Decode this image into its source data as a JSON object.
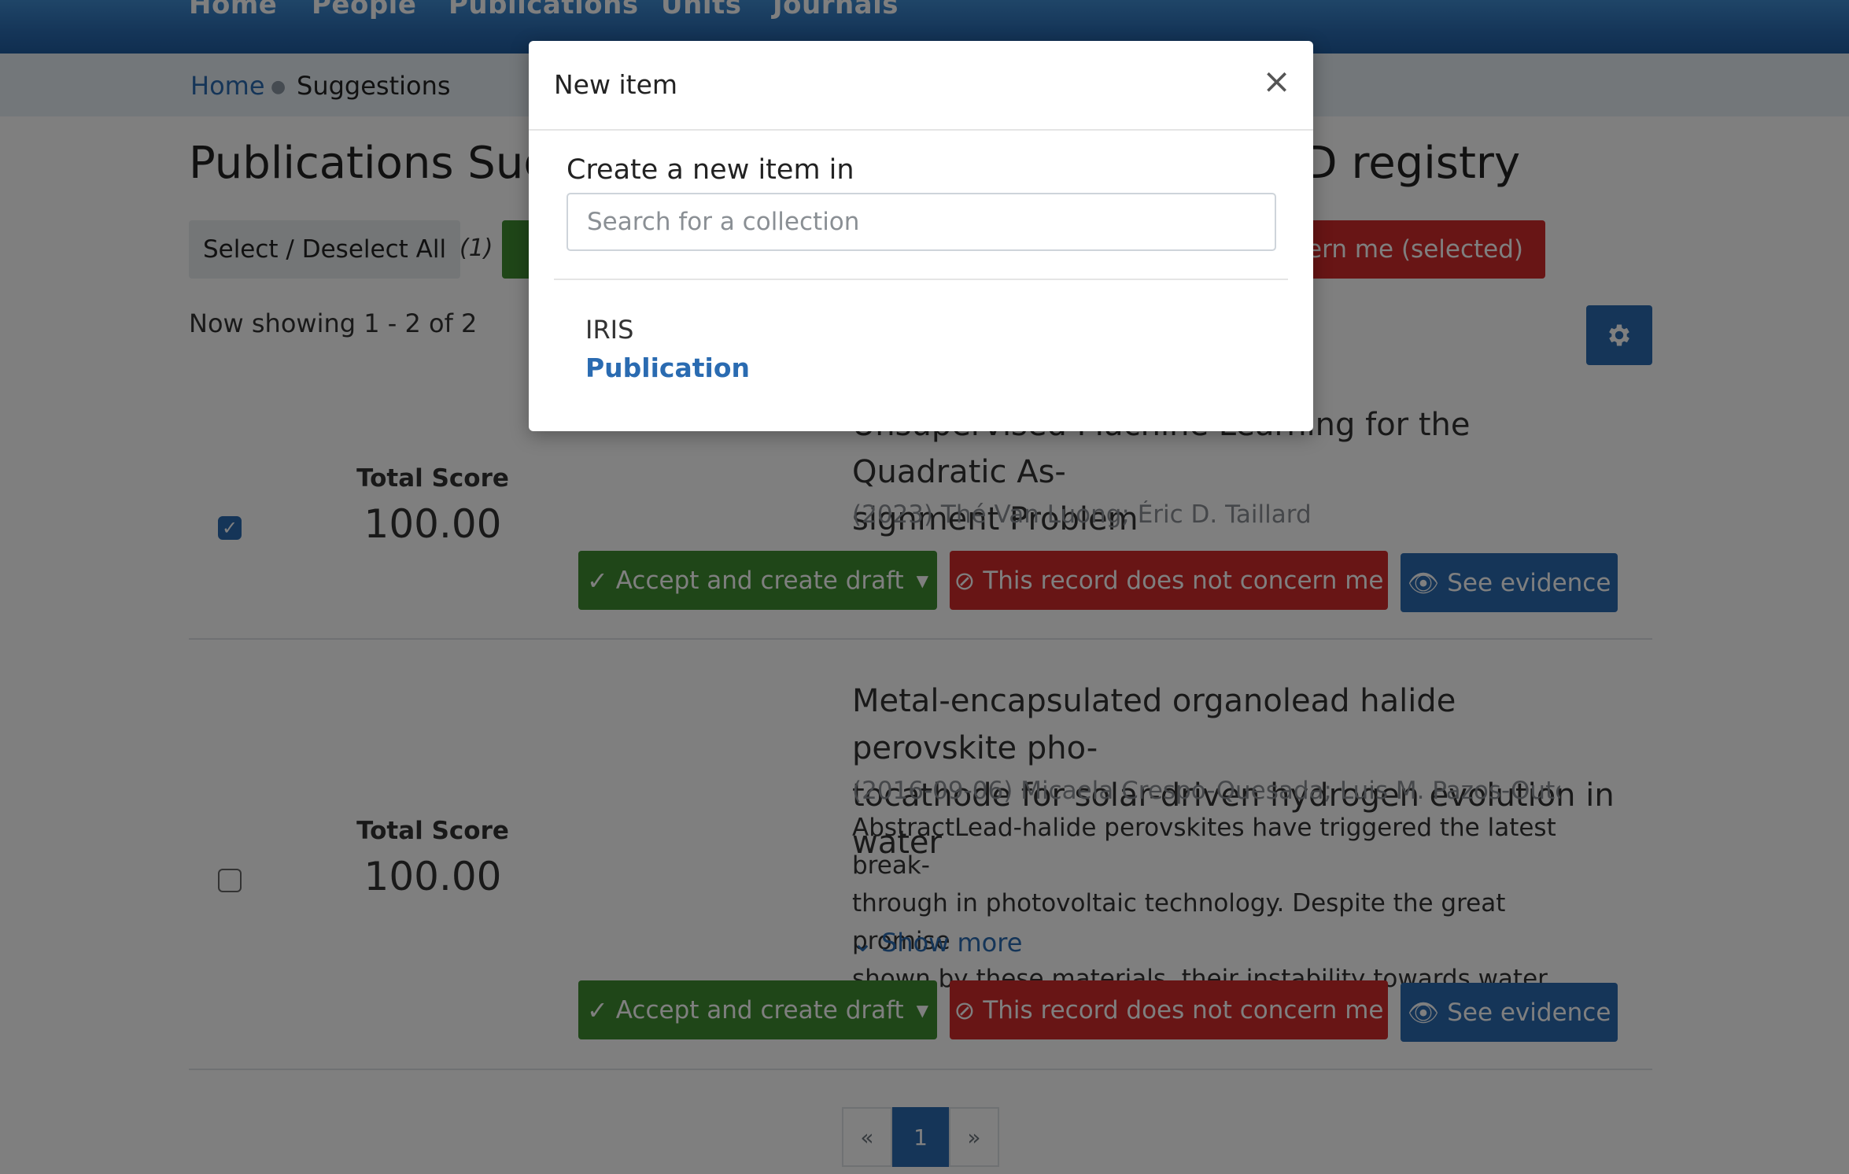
{
  "nav": {
    "items": [
      "Home",
      "People",
      "Publications",
      "Units",
      "Journals"
    ]
  },
  "breadcrumb": {
    "home": "Home",
    "current": "Suggestions"
  },
  "page": {
    "title_left": "Publications Sugg",
    "title_right": "ID registry"
  },
  "toolbar": {
    "select_all": "Select / Deselect All",
    "selected_count": "(1)",
    "reject_selected": "ncern me (selected)"
  },
  "results": {
    "showing": "Now showing 1 - 2 of 2"
  },
  "items": [
    {
      "checked": true,
      "score_label": "Total Score",
      "score": "100.00",
      "title_line1": "Unsupervised Machine Learning for the Quadratic As-",
      "title_line2": "signment Problem",
      "meta": "(2023) Thé Van Luong; Éric D. Taillard",
      "accept": "Accept and create draft",
      "reject": "This record does not concern me",
      "evidence": "See evidence"
    },
    {
      "checked": false,
      "score_label": "Total Score",
      "score": "100.00",
      "title_line1": "Metal-encapsulated organolead halide perovskite pho-",
      "title_line2": "tocathode for solar-driven hydrogen evolution in water",
      "meta": "(2016-09-06) Micaela Crespo-Quesada; Luis M. Pazos-Outón",
      "abstract_line1": "AbstractLead-halide perovskites have triggered the latest break-",
      "abstract_line2": "through in photovoltaic technology. Despite the great promise",
      "abstract_line3": "shown by these materials, their instability towards water even",
      "show_more": "Show more",
      "accept": "Accept and create draft",
      "reject": "This record does not concern me",
      "evidence": "See evidence"
    }
  ],
  "pagination": {
    "prev": "«",
    "current": "1",
    "next": "»"
  },
  "modal": {
    "title": "New item",
    "close": "×",
    "label": "Create a new item in",
    "search_placeholder": "Search for a collection",
    "collection_parent": "IRIS",
    "collection_name": "Publication"
  },
  "colors": {
    "primary": "#2a6bb1",
    "success": "#3f8d31",
    "danger": "#d12b2b"
  }
}
